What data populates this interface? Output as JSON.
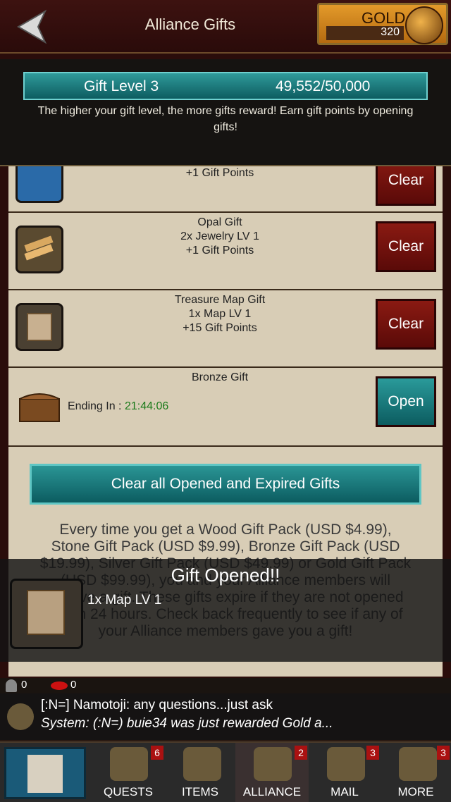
{
  "header": {
    "title": "Alliance Gifts",
    "gold_label": "GOLD",
    "gold_amount": "320"
  },
  "level": {
    "label": "Gift Level 3",
    "points": "49,552/50,000",
    "note": "The higher your gift level, the more gifts reward! Earn gift points by opening gifts!"
  },
  "gifts": [
    {
      "line1": "+1 Gift Points",
      "button": "Clear"
    },
    {
      "line1": "Opal Gift",
      "line2": "2x Jewelry LV 1",
      "line3": "+1 Gift Points",
      "button": "Clear"
    },
    {
      "line1": "Treasure Map Gift",
      "line2": "1x Map LV 1",
      "line3": "+15 Gift Points",
      "button": "Clear"
    },
    {
      "line1": "Bronze Gift",
      "ending_label": "Ending In : ",
      "ending_time": "21:44:06",
      "button": "Open"
    }
  ],
  "clear_all_label": "Clear all Opened and Expired Gifts",
  "info_text": "Every time you get a Wood Gift Pack (USD $4.99), Stone Gift Pack (USD $9.99), Bronze Gift Pack (USD $19.99), Silver Gift Pack (USD $49.99) or Gold Gift Pack (USD $99.99), you and your Alliance members will receive a gift. These gifts expire if they are not opened within 24 hours. Check back frequently to see if any of your Alliance members gave you a gift!",
  "toast": {
    "title": "Gift Opened!!",
    "item": "1x Map LV 1"
  },
  "stats": {
    "a": "0",
    "b": "0"
  },
  "chat": {
    "line1": "[:N=] Namotoji: any questions...just ask",
    "line2": "System: (:N=) buie34 was just rewarded Gold a..."
  },
  "nav": [
    {
      "label": "QUESTS",
      "badge": "6"
    },
    {
      "label": "ITEMS",
      "badge": ""
    },
    {
      "label": "ALLIANCE",
      "badge": "2"
    },
    {
      "label": "MAIL",
      "badge": "3"
    },
    {
      "label": "MORE",
      "badge": "3"
    }
  ],
  "colors": {
    "teal": "#0c5c60",
    "red": "#8a1a12",
    "gold": "#e39a2a"
  }
}
